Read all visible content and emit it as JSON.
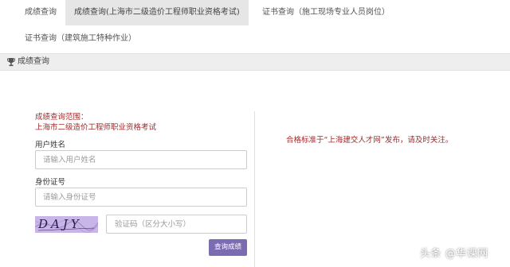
{
  "tabs": [
    {
      "label": "成绩查询",
      "active": false
    },
    {
      "label": "成绩查询(上海市二级造价工程师职业资格考试)",
      "active": true
    },
    {
      "label": "证书查询（施工现场专业人员岗位）",
      "active": false
    },
    {
      "label": "证书查询（建筑施工特种作业）",
      "active": false
    }
  ],
  "section": {
    "icon": "trophy-icon",
    "title": "成绩查询"
  },
  "form": {
    "scope_label": "成绩查询范围：",
    "scope_value": "上海市二级造价工程师职业资格考试",
    "name_label": "用户姓名",
    "name_value": "",
    "name_placeholder": "请输入用户姓名",
    "id_label": "身份证号",
    "id_value": "",
    "id_placeholder": "请输入身份证号",
    "captcha_text": "DAJY",
    "captcha_value": "",
    "captcha_placeholder": "验证码（区分大小写）",
    "submit_label": "查询成绩"
  },
  "notice": "合格标准于“上海建交人才网”发布，请及时关注。",
  "watermark": "头条 @华课网",
  "colors": {
    "accent": "#7b6bb0",
    "notice": "#a52a2a",
    "active_tab": "#e6e6e6",
    "captcha_bg": "#c9b6e8"
  }
}
